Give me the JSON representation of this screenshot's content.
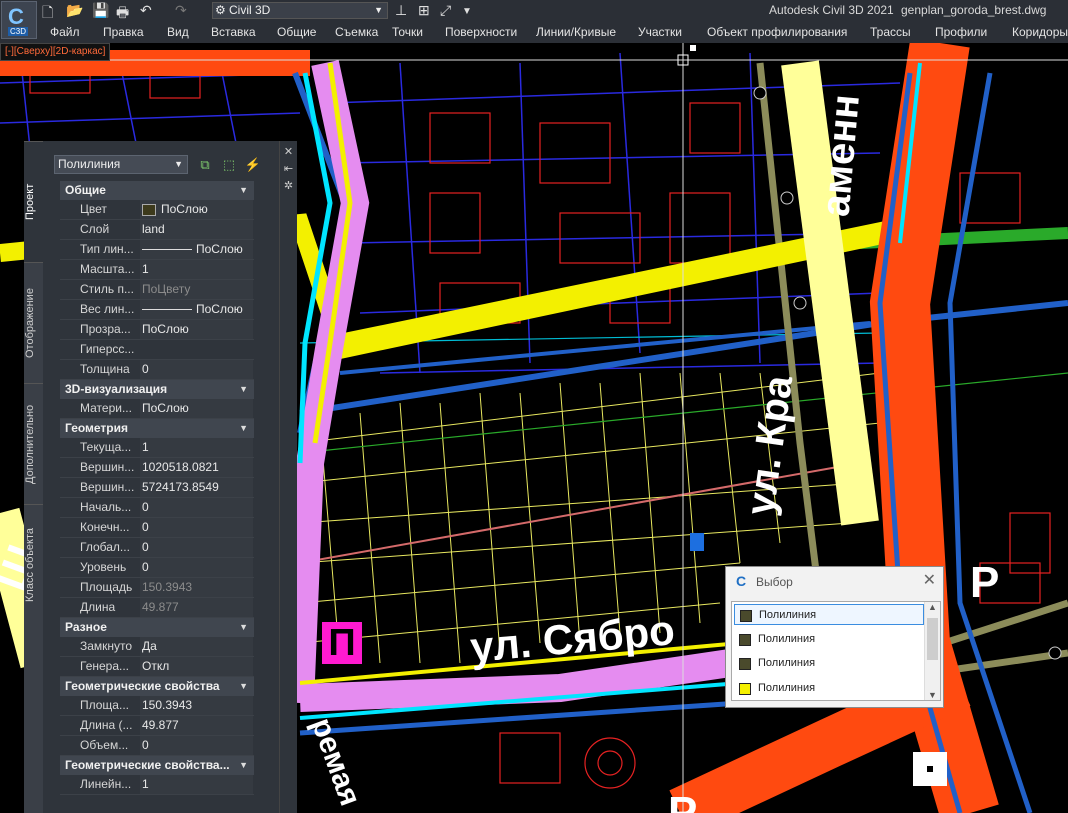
{
  "titlebar": {
    "app_title": "Autodesk Civil 3D 2021",
    "file_name": "genplan_goroda_brest.dwg",
    "workspace": "Civil 3D",
    "logo_letter": "C",
    "logo_badge": "C3D"
  },
  "menu": [
    "Файл",
    "Правка",
    "Вид",
    "Вставка",
    "Общие",
    "Съемка",
    "Точки",
    "Поверхности",
    "Линии/Кривые",
    "Участки",
    "Объект профилирования",
    "Трассы",
    "Профили",
    "Коридоры"
  ],
  "viewport_label": "[-][Сверху][2D-каркас]",
  "drawing_text": {
    "street1": "ул. Сябро",
    "street2": "ул. Кра",
    "street2b": "аменн",
    "street3": "ремая",
    "mark_p": "П",
    "mark_r": "Р",
    "mark_r2": "Р",
    "mark_sh": "Ш"
  },
  "palette": {
    "object_type": "Полилиния",
    "vtabs": [
      "Проект",
      "Отображение",
      "Дополнительно",
      "Класс объекта"
    ],
    "sections": [
      {
        "title": "Общие",
        "rows": [
          {
            "k": "Цвет",
            "v": "ПоСлою",
            "swatch": "#3d3a1c"
          },
          {
            "k": "Слой",
            "v": "land"
          },
          {
            "k": "Тип лин...",
            "v": "ПоСлою",
            "line": true
          },
          {
            "k": "Масшта...",
            "v": "1"
          },
          {
            "k": "Стиль п...",
            "v": "ПоЦвету",
            "gray": true
          },
          {
            "k": "Вес лин...",
            "v": "ПоСлою",
            "line": true
          },
          {
            "k": "Прозра...",
            "v": "ПоСлою"
          },
          {
            "k": "Гиперсс...",
            "v": ""
          },
          {
            "k": "Толщина",
            "v": "0"
          }
        ]
      },
      {
        "title": "3D-визуализация",
        "rows": [
          {
            "k": "Матери...",
            "v": "ПоСлою"
          }
        ]
      },
      {
        "title": "Геометрия",
        "rows": [
          {
            "k": "Текуща...",
            "v": "1"
          },
          {
            "k": "Вершин...",
            "v": "1020518.0821"
          },
          {
            "k": "Вершин...",
            "v": "5724173.8549"
          },
          {
            "k": "Началь...",
            "v": "0"
          },
          {
            "k": "Конечн...",
            "v": "0"
          },
          {
            "k": "Глобал...",
            "v": "0"
          },
          {
            "k": "Уровень",
            "v": "0"
          },
          {
            "k": "Площадь",
            "v": "150.3943",
            "gray": true
          },
          {
            "k": "Длина",
            "v": "49.877",
            "gray": true
          }
        ]
      },
      {
        "title": "Разное",
        "rows": [
          {
            "k": "Замкнуто",
            "v": "Да"
          },
          {
            "k": "Генера...",
            "v": "Откл"
          }
        ]
      },
      {
        "title": "Геометрические свойства",
        "rows": [
          {
            "k": "Площа...",
            "v": "150.3943"
          },
          {
            "k": "Длина (...",
            "v": "49.877"
          },
          {
            "k": "Объем...",
            "v": "0"
          }
        ]
      },
      {
        "title": "Геометрические свойства...",
        "rows": [
          {
            "k": "Линейн...",
            "v": "1"
          }
        ]
      }
    ]
  },
  "selection_dialog": {
    "title": "Выбор",
    "items": [
      {
        "label": "Полилиния",
        "swatch": "#4a4a2c",
        "selected": true
      },
      {
        "label": "Полилиния",
        "swatch": "#4a4a2c",
        "selected": false
      },
      {
        "label": "Полилиния",
        "swatch": "#4a4a2c",
        "selected": false
      },
      {
        "label": "Полилиния",
        "swatch": "#f5f000",
        "selected": false
      }
    ]
  },
  "colors": {
    "road_orange": "#ff4a10",
    "road_yellow": "#f3f000",
    "road_pink": "#e58cf0",
    "road_cyan": "#00e5ff",
    "road_blue": "#2160c8",
    "road_olive": "#8c8c5a",
    "building_red": "#e52222",
    "parcel_yellow": "#e8e860",
    "block_blue": "#2a2ae0",
    "green": "#2a9a2a"
  }
}
